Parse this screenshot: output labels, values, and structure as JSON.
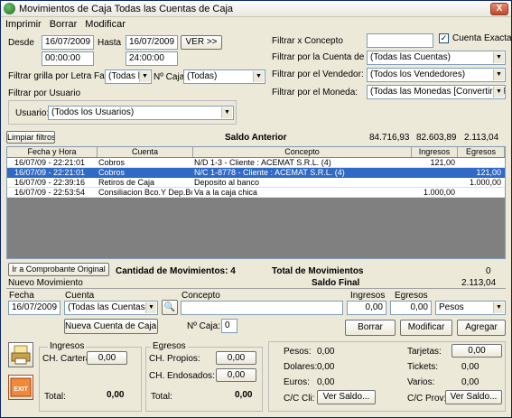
{
  "window": {
    "title": "Movimientos de Caja Todas las Cuentas de Caja",
    "close": "X"
  },
  "menu": [
    "Imprimir",
    "Borrar",
    "Modificar"
  ],
  "filters": {
    "desde_label": "Desde",
    "desde_date": "16/07/2009",
    "desde_time": "00:00:00",
    "hasta_label": "Hasta",
    "hasta_date": "16/07/2009",
    "hasta_time": "24:00:00",
    "ver_button": "VER >>",
    "letra_label": "Filtrar grilla por Letra Factura:",
    "letra_value": "(Todas las",
    "nro_caja_label": "Nº Caja:",
    "nro_caja_value": "(Todas)",
    "usuario_group": "Filtrar por Usuario",
    "usuario_label": "Usuario:",
    "usuario_value": "(Todos los Usuarios)",
    "concepto_label": "Filtrar x Concepto",
    "concepto_value": "",
    "cuenta_exacta_label": "Cuenta Exacta",
    "cuenta_exacta_check": "✓",
    "cuenta_caja_label": "Filtrar por la Cuenta de Caja:",
    "cuenta_caja_value": "(Todas las Cuentas)",
    "vendedor_label": "Filtrar por el Vendedor:",
    "vendedor_value": "(Todos los Vendedores)",
    "moneda_label": "Filtrar por el Moneda:",
    "moneda_value": "(Todas las Monedas [Convertir a Pes"
  },
  "saldo_bar": {
    "limpiar": "Limpiar filtros",
    "saldo_anterior": "Saldo Anterior",
    "v1": "84.716,93",
    "v2": "82.603,89",
    "v3": "2.113,04"
  },
  "grid": {
    "headers": [
      "Fecha y Hora",
      "Cuenta",
      "Concepto",
      "Ingresos",
      "Egresos"
    ],
    "rows": [
      {
        "fecha": "16/07/09 - 22:21:01",
        "cuenta": "Cobros",
        "concepto": "N/D 1-3 - Cliente : ACEMAT S.R.L. (4)",
        "ingresos": "121,00",
        "egresos": ""
      },
      {
        "fecha": "16/07/09 - 22:21:01",
        "cuenta": "Cobros",
        "concepto": "N/C 1-8778 - Cliente : ACEMAT S.R.L. (4)",
        "ingresos": "",
        "egresos": "121,00"
      },
      {
        "fecha": "16/07/09 - 22:39:16",
        "cuenta": "Retiros de Caja",
        "concepto": "Deposito al banco",
        "ingresos": "",
        "egresos": "1.000,00"
      },
      {
        "fecha": "16/07/09 - 22:53:54",
        "cuenta": "Consiliacion Bco.Y Dep.Bc",
        "concepto": "Va a la caja chica",
        "ingresos": "1.000,00",
        "egresos": ""
      }
    ]
  },
  "summary": {
    "ir_button": "Ir a Comprobante Original",
    "cantidad_label": "Cantidad de Movimientos: 4",
    "total_mov_label": "Total de Movimientos",
    "total_mov_value": "0",
    "saldo_final_label": "Saldo Final",
    "saldo_final_value": "2.113,04"
  },
  "nuevo": {
    "title": "Nuevo Movimiento",
    "fecha_label": "Fecha",
    "fecha_value": "16/07/2009",
    "cuenta_label": "Cuenta",
    "cuenta_value": "(Todas las Cuentas)",
    "concepto_label": "Concepto",
    "concepto_value": "",
    "ingresos_label": "Ingresos",
    "ingresos_value": "0,00",
    "egresos_label": "Egresos",
    "egresos_value": "0,00",
    "moneda_value": "Pesos",
    "nueva_cuenta": "Nueva Cuenta de Caja...",
    "nro_caja_label": "Nº Caja:",
    "nro_caja_value": "0",
    "borrar": "Borrar",
    "modificar": "Modificar",
    "agregar": "Agregar"
  },
  "totals": {
    "ingresos_group": "Ingresos",
    "ch_cartera_label": "CH. Cartera:",
    "ch_cartera_value": "0,00",
    "total_ing_label": "Total:",
    "total_ing_value": "0,00",
    "egresos_group": "Egresos",
    "ch_propios_label": "CH. Propios:",
    "ch_propios_value": "0,00",
    "ch_endosados_label": "CH. Endosados:",
    "ch_endosados_value": "0,00",
    "total_egr_label": "Total:",
    "total_egr_value": "0,00",
    "pesos_label": "Pesos:",
    "pesos_value": "0,00",
    "dolares_label": "Dolares:",
    "dolares_value": "0,00",
    "euros_label": "Euros:",
    "euros_value": "0,00",
    "cc_cli_label": "C/C Cli:",
    "ver_saldo_cli": "Ver Saldo...",
    "tarjetas_label": "Tarjetas:",
    "tarjetas_value": "0,00",
    "tickets_label": "Tickets:",
    "tickets_value": "0,00",
    "varios_label": "Varios:",
    "varios_value": "0,00",
    "cc_prov_label": "C/C Prov:",
    "ver_saldo_prov": "Ver Saldo..."
  },
  "icons": {
    "print": "print-icon",
    "exit": "exit-icon",
    "exit_text": "EXIT",
    "search": "magnifier-icon"
  }
}
